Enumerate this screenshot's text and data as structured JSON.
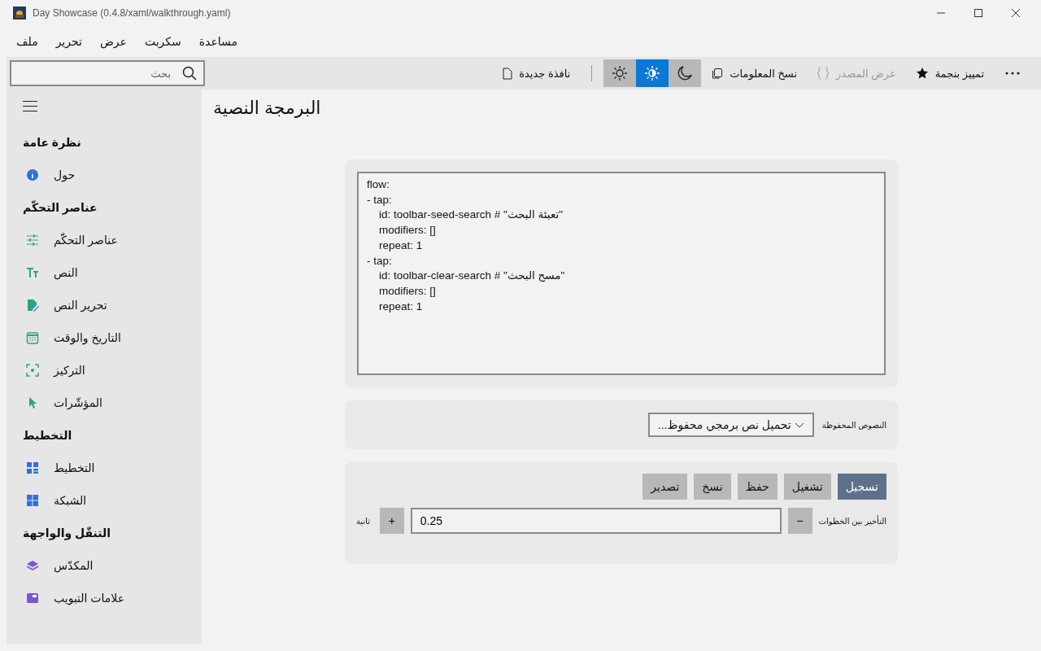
{
  "window": {
    "title": "Day Showcase (0.4.8/xaml/walkthrough.yaml)"
  },
  "menu": [
    "مساعدة",
    "سكربت",
    "عرض",
    "تحرير",
    "ملف"
  ],
  "search": {
    "placeholder": "بحث"
  },
  "toolbar": {
    "new_window": "نافذة جديدة",
    "theme_options": [
      {
        "selected": false
      },
      {
        "selected": true
      },
      {
        "selected": false
      }
    ],
    "actions": [
      {
        "label": "تمييز بنجمة",
        "disabled": false
      },
      {
        "label": "عرض المصدر",
        "disabled": true
      },
      {
        "label": "نسخ المعلومات",
        "disabled": false
      }
    ]
  },
  "sidebar": {
    "groups": [
      {
        "heading": "نظرة عامة",
        "items": [
          "حول"
        ]
      },
      {
        "heading": "عناصر التحكّم",
        "items": [
          "عناصر التحكّم",
          "النص",
          "تحرير النص",
          "التاريخ والوقت",
          "التركيز",
          "المؤشّرات"
        ]
      },
      {
        "heading": "التخطيط",
        "items": [
          "التخطيط",
          "الشبكة"
        ]
      },
      {
        "heading": "التنقّل والواجهة",
        "items": [
          "المكدّس",
          "علامات التبويب"
        ]
      }
    ]
  },
  "page_title": "البرمجة النصية",
  "script_lines": [
    "flow:",
    "- tap:",
    "    id: toolbar-seed-search # \"تعبئة البحث\"",
    "    modifiers: []",
    "    repeat: 1",
    "- tap:",
    "    id: toolbar-clear-search # \"مسح البحث\"",
    "    modifiers: []",
    "    repeat: 1"
  ],
  "saved_scripts": {
    "label": "النصوص المحفوظة",
    "value": "تحميل نص برمجي محفوظ..."
  },
  "buttons": [
    {
      "label": "تسجيل",
      "active": true
    },
    {
      "label": "تشغيل",
      "active": false
    },
    {
      "label": "حفظ",
      "active": false
    },
    {
      "label": "نسخ",
      "active": false
    },
    {
      "label": "تصدير",
      "active": false
    }
  ],
  "delay": {
    "unit": "ثانية",
    "increment": "+",
    "value": "0.25",
    "decrement": "−",
    "label": "التأخير بين الخطوات"
  }
}
